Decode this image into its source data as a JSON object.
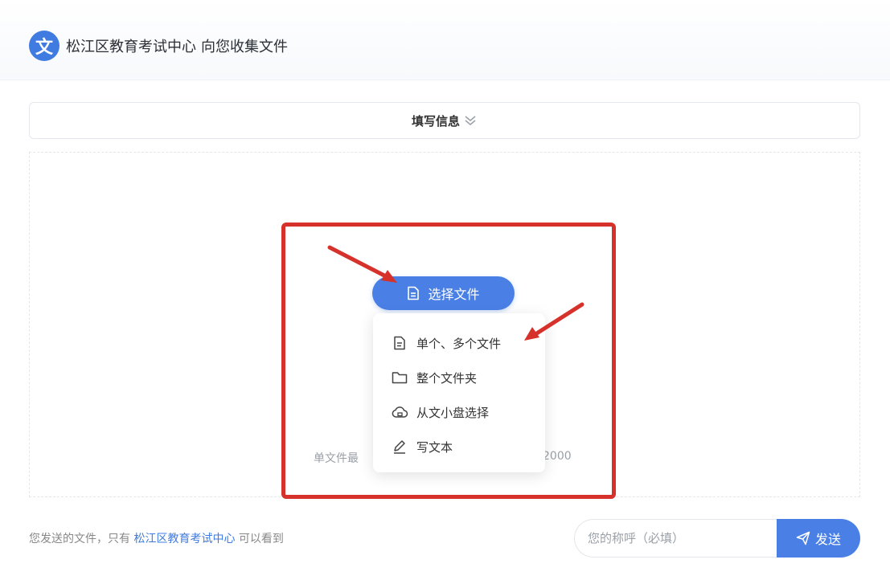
{
  "header": {
    "logo_glyph": "文",
    "org_name": "松江区教育考试中心",
    "title_suffix": "向您收集文件"
  },
  "info_bar": {
    "label": "填写信息"
  },
  "upload": {
    "select_button_label": "选择文件",
    "hint_left": "单文件最",
    "hint_right": "2000",
    "menu_items": [
      {
        "label": "单个、多个文件",
        "icon": "file-icon"
      },
      {
        "label": "整个文件夹",
        "icon": "folder-icon"
      },
      {
        "label": "从文小盘选择",
        "icon": "cloud-icon"
      },
      {
        "label": "写文本",
        "icon": "pencil-icon"
      }
    ]
  },
  "footer": {
    "note_prefix": "您发送的文件，只有",
    "note_org": "松江区教育考试中心",
    "note_suffix": "可以看到",
    "name_placeholder": "您的称呼（必填）",
    "send_label": "发送"
  },
  "colors": {
    "accent": "#4a80e6",
    "highlight": "#d6312a"
  }
}
